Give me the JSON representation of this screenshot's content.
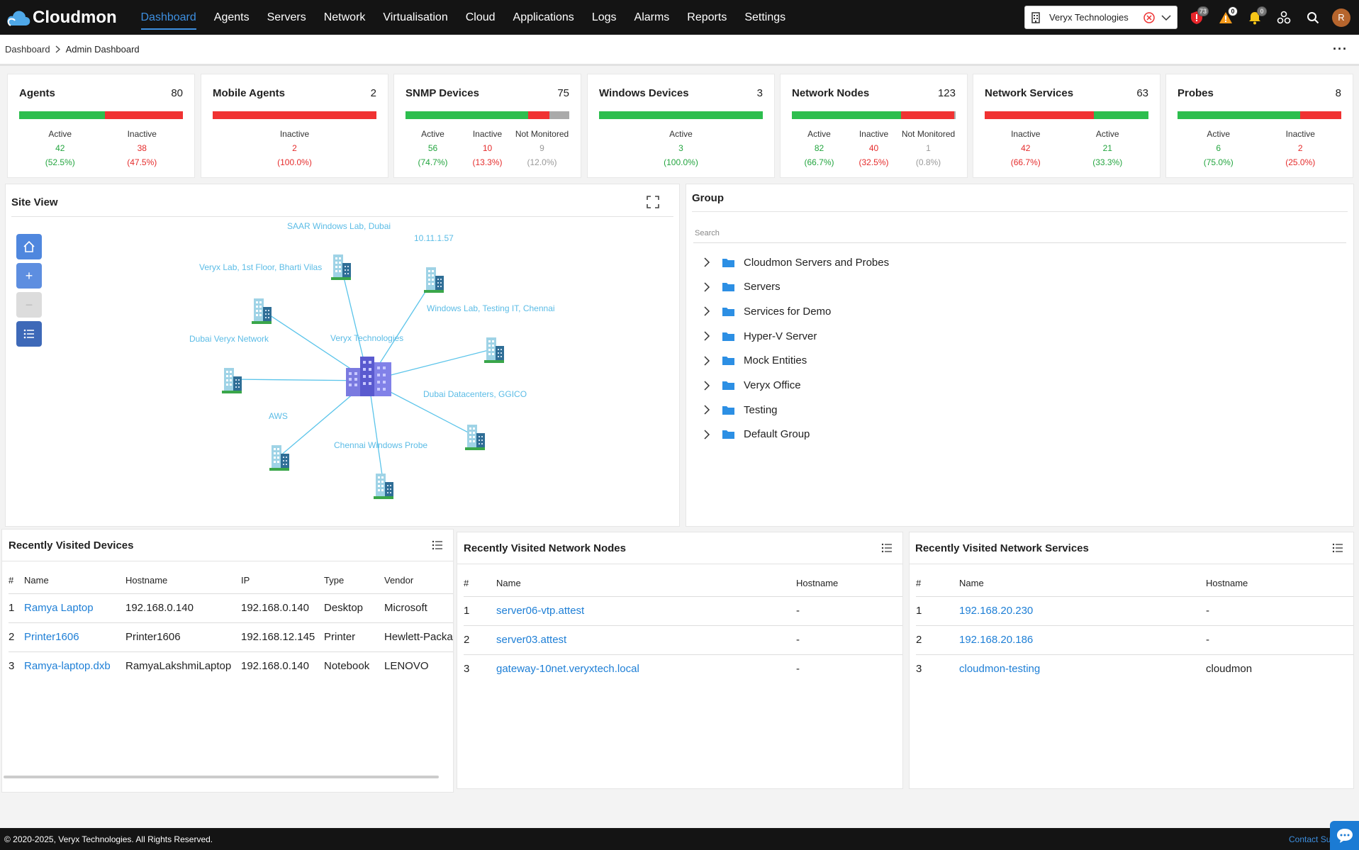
{
  "app": {
    "name": "Cloudmon"
  },
  "nav": {
    "items": [
      {
        "label": "Dashboard",
        "active": true
      },
      {
        "label": "Agents"
      },
      {
        "label": "Servers"
      },
      {
        "label": "Network"
      },
      {
        "label": "Virtualisation"
      },
      {
        "label": "Cloud"
      },
      {
        "label": "Applications"
      },
      {
        "label": "Logs"
      },
      {
        "label": "Alarms"
      },
      {
        "label": "Reports"
      },
      {
        "label": "Settings"
      }
    ]
  },
  "tenant": {
    "selected": "Veryx Technologies"
  },
  "notifications": {
    "shield_count": "73",
    "warning_count": "0",
    "bell_count": "0"
  },
  "user": {
    "initial": "R"
  },
  "breadcrumb": {
    "root": "Dashboard",
    "current": "Admin Dashboard"
  },
  "stat_cards": [
    {
      "title": "Agents",
      "count": "80",
      "bar": [
        {
          "pct": 52.5,
          "color": "#2dbe4e"
        },
        {
          "pct": 47.5,
          "color": "#f03232"
        }
      ],
      "stats": [
        {
          "label": "Active",
          "value": "42",
          "pct": "(52.5%)",
          "color": "#23a53f"
        },
        {
          "label": "Inactive",
          "value": "38",
          "pct": "(47.5%)",
          "color": "#e52b2b"
        }
      ]
    },
    {
      "title": "Mobile Agents",
      "count": "2",
      "bar": [
        {
          "pct": 100,
          "color": "#f03232"
        }
      ],
      "stats": [
        {
          "label": "Inactive",
          "value": "2",
          "pct": "(100.0%)",
          "color": "#e52b2b"
        }
      ]
    },
    {
      "title": "SNMP Devices",
      "count": "75",
      "bar": [
        {
          "pct": 74.7,
          "color": "#2dbe4e"
        },
        {
          "pct": 13.3,
          "color": "#f03232"
        },
        {
          "pct": 12.0,
          "color": "#aaaaaa"
        }
      ],
      "stats": [
        {
          "label": "Active",
          "value": "56",
          "pct": "(74.7%)",
          "color": "#23a53f"
        },
        {
          "label": "Inactive",
          "value": "10",
          "pct": "(13.3%)",
          "color": "#e52b2b"
        },
        {
          "label": "Not Monitored",
          "value": "9",
          "pct": "(12.0%)",
          "color": "#999999"
        }
      ]
    },
    {
      "title": "Windows Devices",
      "count": "3",
      "bar": [
        {
          "pct": 100,
          "color": "#2dbe4e"
        }
      ],
      "stats": [
        {
          "label": "Active",
          "value": "3",
          "pct": "(100.0%)",
          "color": "#23a53f"
        }
      ]
    },
    {
      "title": "Network Nodes",
      "count": "123",
      "bar": [
        {
          "pct": 66.7,
          "color": "#2dbe4e"
        },
        {
          "pct": 32.5,
          "color": "#f03232"
        },
        {
          "pct": 0.8,
          "color": "#aaaaaa"
        }
      ],
      "stats": [
        {
          "label": "Active",
          "value": "82",
          "pct": "(66.7%)",
          "color": "#23a53f"
        },
        {
          "label": "Inactive",
          "value": "40",
          "pct": "(32.5%)",
          "color": "#e52b2b"
        },
        {
          "label": "Not Monitored",
          "value": "1",
          "pct": "(0.8%)",
          "color": "#999999"
        }
      ]
    },
    {
      "title": "Network Services",
      "count": "63",
      "bar": [
        {
          "pct": 66.7,
          "color": "#f03232"
        },
        {
          "pct": 33.3,
          "color": "#2dbe4e"
        }
      ],
      "stats": [
        {
          "label": "Inactive",
          "value": "42",
          "pct": "(66.7%)",
          "color": "#e52b2b"
        },
        {
          "label": "Active",
          "value": "21",
          "pct": "(33.3%)",
          "color": "#23a53f"
        }
      ]
    },
    {
      "title": "Probes",
      "count": "8",
      "bar": [
        {
          "pct": 75.0,
          "color": "#2dbe4e"
        },
        {
          "pct": 25.0,
          "color": "#f03232"
        }
      ],
      "stats": [
        {
          "label": "Active",
          "value": "6",
          "pct": "(75.0%)",
          "color": "#23a53f"
        },
        {
          "label": "Inactive",
          "value": "2",
          "pct": "(25.0%)",
          "color": "#e52b2b"
        }
      ]
    }
  ],
  "site_view": {
    "title": "Site View",
    "center_label": "Veryx Technologies",
    "sites": [
      {
        "label": "SAAR Windows Lab, Dubai"
      },
      {
        "label": "10.11.1.57"
      },
      {
        "label": "Veryx Lab, 1st Floor, Bharti Vilas"
      },
      {
        "label": "Windows Lab, Testing IT, Chennai"
      },
      {
        "label": "Dubai Veryx Network"
      },
      {
        "label": "Dubai Datacenters, GGICO"
      },
      {
        "label": "AWS"
      },
      {
        "label": "Chennai Windows Probe"
      }
    ]
  },
  "group": {
    "title": "Group",
    "search_placeholder": "Search",
    "items": [
      "Cloudmon Servers and Probes",
      "Servers",
      "Services for Demo",
      "Hyper-V Server",
      "Mock Entities",
      "Veryx Office",
      "Testing",
      "Default Group"
    ]
  },
  "recent_devices": {
    "title": "Recently Visited Devices",
    "columns": [
      "#",
      "Name",
      "Hostname",
      "IP",
      "Type",
      "Vendor"
    ],
    "rows": [
      [
        "1",
        "Ramya Laptop",
        "192.168.0.140",
        "192.168.0.140",
        "Desktop",
        "Microsoft"
      ],
      [
        "2",
        "Printer1606",
        "Printer1606",
        "192.168.12.145",
        "Printer",
        "Hewlett-Packa"
      ],
      [
        "3",
        "Ramya-laptop.dxb",
        "RamyaLakshmiLaptop",
        "192.168.0.140",
        "Notebook",
        "LENOVO"
      ]
    ]
  },
  "recent_nodes": {
    "title": "Recently Visited Network Nodes",
    "columns": [
      "#",
      "Name",
      "Hostname"
    ],
    "rows": [
      [
        "1",
        "server06-vtp.attest",
        "-"
      ],
      [
        "2",
        "server03.attest",
        "-"
      ],
      [
        "3",
        "gateway-10net.veryxtech.local",
        "-"
      ]
    ]
  },
  "recent_services": {
    "title": "Recently Visited Network Services",
    "columns": [
      "#",
      "Name",
      "Hostname"
    ],
    "rows": [
      [
        "1",
        "192.168.20.230",
        "-"
      ],
      [
        "2",
        "192.168.20.186",
        "-"
      ],
      [
        "3",
        "cloudmon-testing",
        "cloudmon"
      ]
    ]
  },
  "footer": {
    "copyright": "© 2020-2025, Veryx Technologies. All Rights Reserved.",
    "contact": "Contact Support"
  }
}
